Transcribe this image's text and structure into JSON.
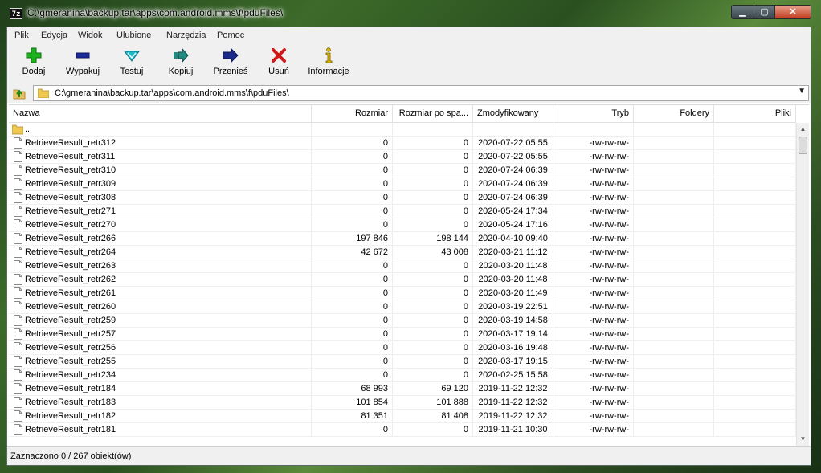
{
  "window": {
    "title": "C:\\gmeranina\\backup.tar\\apps\\com.android.mms\\f\\pduFiles\\",
    "app_icon_text": "7z"
  },
  "menu": [
    "Plik",
    "Edycja",
    "Widok",
    "Ulubione",
    "Narzędzia",
    "Pomoc"
  ],
  "toolbar": {
    "add": "Dodaj",
    "extract": "Wypakuj",
    "test": "Testuj",
    "copy": "Kopiuj",
    "move": "Przenieś",
    "delete": "Usuń",
    "info": "Informacje"
  },
  "address": {
    "path": "C:\\gmeranina\\backup.tar\\apps\\com.android.mms\\f\\pduFiles\\"
  },
  "columns": {
    "name": "Nazwa",
    "size": "Rozmiar",
    "packed": "Rozmiar po spa...",
    "modified": "Zmodyfikowany",
    "attr": "Tryb",
    "folders": "Foldery",
    "files": "Pliki"
  },
  "parent_row": "..",
  "files": [
    {
      "name": "RetrieveResult_retr312",
      "size": "0",
      "packed": "0",
      "modified": "2020-07-22 05:55",
      "attr": "-rw-rw-rw-"
    },
    {
      "name": "RetrieveResult_retr311",
      "size": "0",
      "packed": "0",
      "modified": "2020-07-22 05:55",
      "attr": "-rw-rw-rw-"
    },
    {
      "name": "RetrieveResult_retr310",
      "size": "0",
      "packed": "0",
      "modified": "2020-07-24 06:39",
      "attr": "-rw-rw-rw-"
    },
    {
      "name": "RetrieveResult_retr309",
      "size": "0",
      "packed": "0",
      "modified": "2020-07-24 06:39",
      "attr": "-rw-rw-rw-"
    },
    {
      "name": "RetrieveResult_retr308",
      "size": "0",
      "packed": "0",
      "modified": "2020-07-24 06:39",
      "attr": "-rw-rw-rw-"
    },
    {
      "name": "RetrieveResult_retr271",
      "size": "0",
      "packed": "0",
      "modified": "2020-05-24 17:34",
      "attr": "-rw-rw-rw-"
    },
    {
      "name": "RetrieveResult_retr270",
      "size": "0",
      "packed": "0",
      "modified": "2020-05-24 17:16",
      "attr": "-rw-rw-rw-"
    },
    {
      "name": "RetrieveResult_retr266",
      "size": "197 846",
      "packed": "198 144",
      "modified": "2020-04-10 09:40",
      "attr": "-rw-rw-rw-"
    },
    {
      "name": "RetrieveResult_retr264",
      "size": "42 672",
      "packed": "43 008",
      "modified": "2020-03-21 11:12",
      "attr": "-rw-rw-rw-"
    },
    {
      "name": "RetrieveResult_retr263",
      "size": "0",
      "packed": "0",
      "modified": "2020-03-20 11:48",
      "attr": "-rw-rw-rw-"
    },
    {
      "name": "RetrieveResult_retr262",
      "size": "0",
      "packed": "0",
      "modified": "2020-03-20 11:48",
      "attr": "-rw-rw-rw-"
    },
    {
      "name": "RetrieveResult_retr261",
      "size": "0",
      "packed": "0",
      "modified": "2020-03-20 11:49",
      "attr": "-rw-rw-rw-"
    },
    {
      "name": "RetrieveResult_retr260",
      "size": "0",
      "packed": "0",
      "modified": "2020-03-19 22:51",
      "attr": "-rw-rw-rw-"
    },
    {
      "name": "RetrieveResult_retr259",
      "size": "0",
      "packed": "0",
      "modified": "2020-03-19 14:58",
      "attr": "-rw-rw-rw-"
    },
    {
      "name": "RetrieveResult_retr257",
      "size": "0",
      "packed": "0",
      "modified": "2020-03-17 19:14",
      "attr": "-rw-rw-rw-"
    },
    {
      "name": "RetrieveResult_retr256",
      "size": "0",
      "packed": "0",
      "modified": "2020-03-16 19:48",
      "attr": "-rw-rw-rw-"
    },
    {
      "name": "RetrieveResult_retr255",
      "size": "0",
      "packed": "0",
      "modified": "2020-03-17 19:15",
      "attr": "-rw-rw-rw-"
    },
    {
      "name": "RetrieveResult_retr234",
      "size": "0",
      "packed": "0",
      "modified": "2020-02-25 15:58",
      "attr": "-rw-rw-rw-"
    },
    {
      "name": "RetrieveResult_retr184",
      "size": "68 993",
      "packed": "69 120",
      "modified": "2019-11-22 12:32",
      "attr": "-rw-rw-rw-"
    },
    {
      "name": "RetrieveResult_retr183",
      "size": "101 854",
      "packed": "101 888",
      "modified": "2019-11-22 12:32",
      "attr": "-rw-rw-rw-"
    },
    {
      "name": "RetrieveResult_retr182",
      "size": "81 351",
      "packed": "81 408",
      "modified": "2019-11-22 12:32",
      "attr": "-rw-rw-rw-"
    },
    {
      "name": "RetrieveResult_retr181",
      "size": "0",
      "packed": "0",
      "modified": "2019-11-21 10:30",
      "attr": "-rw-rw-rw-"
    }
  ],
  "status": "Zaznaczono 0 / 267 obiekt(ów)",
  "icons": {
    "add": "plus-icon",
    "extract": "minus-icon",
    "test": "check-icon",
    "copy": "copy-arrow-icon",
    "move": "move-arrow-icon",
    "delete": "x-icon",
    "info": "info-icon"
  },
  "colors": {
    "add": "#1db31d",
    "extract": "#1a2a9a",
    "test": "#1fb8c8",
    "copy": "#1f8a80",
    "move": "#1a2a8a",
    "delete": "#d01818",
    "info": "#e8c400"
  }
}
